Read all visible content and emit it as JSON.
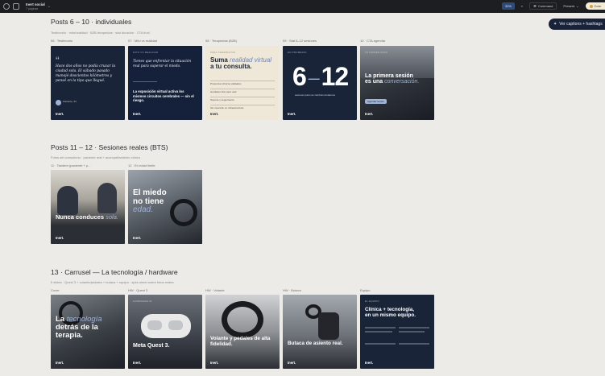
{
  "app": {
    "title": "Inert social",
    "subtitle": "7 páginas"
  },
  "toolbar": {
    "zoom": "33%",
    "command": "Command",
    "present": "Present",
    "share": "Com"
  },
  "pill": {
    "label": "Ver captions + hashtags"
  },
  "sections": [
    {
      "title": "Posts 6 – 10 · individuales",
      "subtitle": "Testimonio · mito/realidad · B2B terapeutas · stat duración · CTA final",
      "cards": [
        {
          "caption": "06 · Testimonio",
          "style": "testimonio",
          "text": "Hace dos años no podía cruzar la ciudad sola. El sábado pasado manejé doscientos kilómetros y pensé en la tipo que llegué.",
          "author": "Paciente, 34",
          "brand": "Inert."
        },
        {
          "caption": "07 · Mito vs realidad",
          "style": "mito",
          "tag": "MITO VS REALIDAD",
          "text": "Tienes que enfrentar la situación real para superar el miedo.",
          "text2": "La exposición virtual activa los mismos circuitos cerebrales — sin el riesgo.",
          "brand": "Inert."
        },
        {
          "caption": "08 · Terapeutas (B2B)",
          "style": "terapeutas",
          "tag": "PARA TERAPEUTAS",
          "text_a": "Suma",
          "text_b": "realidad virtual",
          "text_c": "a tu consulta.",
          "items": [
            "Protocolos clínicos validados",
            "Hardware listo para usar",
            "Soporte y seguimiento",
            "Sin inversión en infraestructura"
          ],
          "brand": "Inert."
        },
        {
          "caption": "09 · Stat 6–12 sesiones",
          "style": "stat",
          "tag": "EN PROMEDIO",
          "text_a": "6",
          "text_b": "12",
          "sub": "sesiones para ver cambios duraderos",
          "brand": "Inert."
        },
        {
          "caption": "10 · CTA agendar",
          "style": "cta",
          "tag": "TU PRIMER PASO",
          "text_a": "La primera sesión",
          "text_b": "es una",
          "text_c": "conversación.",
          "button": "Agendar sesión",
          "brand": "Inert."
        }
      ]
    },
    {
      "title": "Posts 11 – 12 · Sesiones reales (BTS)",
      "subtitle": "Fotos del consultorio · paciente real + acompañamiento clínico",
      "cards": [
        {
          "caption": "11 · Tandem (paciente + p...",
          "style": "tandem",
          "text_a": "Nunca conduces",
          "text_b": "sola.",
          "brand": "Inert."
        },
        {
          "caption": "12 · En edad límite",
          "style": "volante",
          "text_a": "El miedo",
          "text_b": "no tiene",
          "text_c": "edad.",
          "brand": "Inert."
        }
      ]
    },
    {
      "title": "13 · Carrusel — La tecnología / hardware",
      "subtitle": "5 slides · Quest 3 + volante/pedales + butaca + equipo · spec sheet sobre fotos reales",
      "cards": [
        {
          "caption": "Cover",
          "style": "cover",
          "text_a": "La",
          "text_b": "tecnología",
          "text_c": "detrás de la",
          "text_d": "terapia.",
          "brand": "Inert."
        },
        {
          "caption": "HW · Quest 3",
          "style": "quest",
          "tag": "HARDWARE 01",
          "text_a": "Meta Quest 3.",
          "brand": "Inert."
        },
        {
          "caption": "HW · Volante",
          "style": "volante2",
          "text_a": "Volante y pedales de alta fidelidad.",
          "brand": "Inert."
        },
        {
          "caption": "HW · Butaca",
          "style": "butaca",
          "text_a": "Butaca de asiento real.",
          "brand": "Inert."
        },
        {
          "caption": "Equipo",
          "style": "equipo",
          "tag": "EL EQUIPO",
          "text_a": "Clínica + tecnología,",
          "text_b": "en un mismo equipo.",
          "brand": "Inert."
        }
      ]
    }
  ]
}
